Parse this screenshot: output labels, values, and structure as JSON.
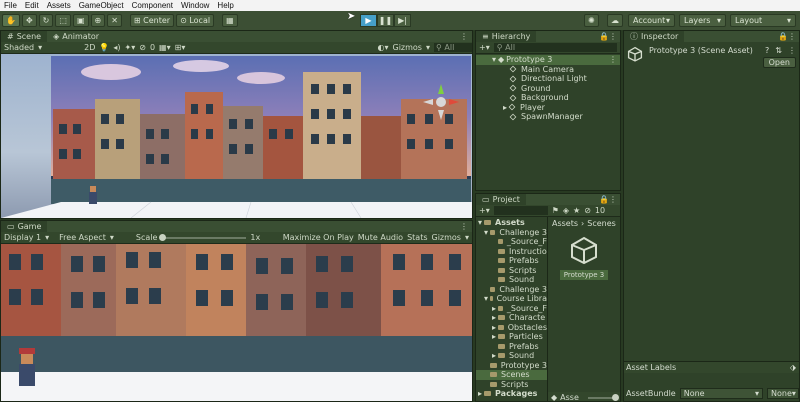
{
  "menu": [
    "File",
    "Edit",
    "Assets",
    "GameObject",
    "Component",
    "Window",
    "Help"
  ],
  "toolbar": {
    "center_label": "Center",
    "local_label": "Local",
    "account_label": "Account",
    "layers_label": "Layers",
    "layout_label": "Layout"
  },
  "scene_panel": {
    "tabs": [
      "Scene",
      "Animator"
    ],
    "shading": "Shaded",
    "mode_2d": "2D",
    "gizmos_label": "Gizmos",
    "search_placeholder": "All",
    "hidden_count": "0"
  },
  "game_panel": {
    "tab": "Game",
    "display": "Display 1",
    "aspect": "Free Aspect",
    "scale_label": "Scale",
    "scale_value": "1x",
    "maximize_label": "Maximize On Play",
    "mute_label": "Mute Audio",
    "stats_label": "Stats",
    "gizmos_label": "Gizmos"
  },
  "hierarchy": {
    "tab": "Hierarchy",
    "search_placeholder": "All",
    "scene_name": "Prototype 3",
    "items": [
      "Main Camera",
      "Directional Light",
      "Ground",
      "Background",
      "Player",
      "SpawnManager"
    ]
  },
  "project": {
    "tab": "Project",
    "hidden_count": "10",
    "breadcrumb": [
      "Assets",
      "Scenes"
    ],
    "tree": [
      {
        "label": "Assets",
        "depth": 0
      },
      {
        "label": "Challenge 3",
        "depth": 1
      },
      {
        "label": "_Source_F",
        "depth": 2
      },
      {
        "label": "Instructio",
        "depth": 2
      },
      {
        "label": "Prefabs",
        "depth": 2
      },
      {
        "label": "Scripts",
        "depth": 2
      },
      {
        "label": "Sound",
        "depth": 2
      },
      {
        "label": "Challenge 3",
        "depth": 1
      },
      {
        "label": "Course Libra",
        "depth": 1
      },
      {
        "label": "_Source_F",
        "depth": 2
      },
      {
        "label": "Characte",
        "depth": 2
      },
      {
        "label": "Obstacles",
        "depth": 2
      },
      {
        "label": "Particles",
        "depth": 2
      },
      {
        "label": "Prefabs",
        "depth": 2
      },
      {
        "label": "Sound",
        "depth": 2
      },
      {
        "label": "Prototype 3",
        "depth": 1
      },
      {
        "label": "Scenes",
        "depth": 1
      },
      {
        "label": "Scripts",
        "depth": 1
      },
      {
        "label": "Packages",
        "depth": 0
      }
    ],
    "asset_name": "Prototype 3",
    "footer_label": "Asse"
  },
  "inspector": {
    "tab": "Inspector",
    "title": "Prototype 3 (Scene Asset)",
    "open_label": "Open",
    "asset_labels": "Asset Labels",
    "asset_bundle_label": "AssetBundle",
    "bundle_value": "None",
    "variant_value": "None"
  },
  "colors": {
    "accent_play": "#46a0c8",
    "panel_bg": "#2f4229",
    "selection": "#4a6a3e"
  }
}
